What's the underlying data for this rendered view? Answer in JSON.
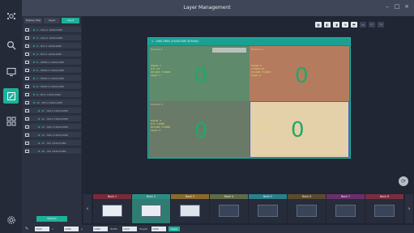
{
  "window": {
    "title": "Layer Management"
  },
  "colors": {
    "accent": "#1db09a",
    "screen_border": "#20b3a4",
    "selected_window_border": "#4b62c4"
  },
  "rail": {
    "items": [
      {
        "icon": "settings-cluster-icon"
      },
      {
        "icon": "search-icon"
      },
      {
        "icon": "monitor-icon"
      },
      {
        "icon": "layer-edit-icon",
        "active": true
      },
      {
        "icon": "grid-icon"
      },
      {
        "icon": "gear-icon"
      }
    ]
  },
  "panel": {
    "tabs": [
      {
        "label": "Display Disp"
      },
      {
        "label": "Layer"
      },
      {
        "label": "Input"
      }
    ],
    "rows": [
      {
        "label": "1 - VGA-1 1920x1080"
      },
      {
        "label": "2 - VGA-2 1920x1080"
      },
      {
        "label": "3 - DVI-1 1920x1080"
      },
      {
        "label": "4 - DVI-2 1920x1080"
      },
      {
        "label": "5 - HDMI-1 1920x1080"
      },
      {
        "label": "6 - HDMI-2 1920x1080"
      },
      {
        "label": "7 - HDMI-3 1920x1080"
      },
      {
        "label": "8 - HDMI-4 1920x1080"
      },
      {
        "label": "9 - DP-1 1920x1080"
      },
      {
        "label": "10 - DP-2 1920x1080"
      },
      {
        "label": "11 - SDI-1 1920x1080"
      },
      {
        "label": "12 - SDI-2 1920x1080"
      },
      {
        "label": "13 - SDI-3 1920x1080"
      },
      {
        "label": "14 - SDI-4 1920x1080"
      },
      {
        "label": "15 - IP-1 1920x1080"
      },
      {
        "label": "16 - IP-2 1920x1080"
      }
    ],
    "action_label": "Refresh"
  },
  "toolbar": {
    "buttons": [
      "▦",
      "◧",
      "◨",
      "⊞",
      "⬒",
      "≡",
      "↶",
      "↷"
    ]
  },
  "screen": {
    "title": "1 - 1080 DMIX (1920X1080 @ 60Hz)",
    "windows": [
      {
        "name": "Window 1",
        "info": "Signal: 1\nX:0  Y:0\nW:1920  H:1080\nLayer: 1",
        "value": "0"
      },
      {
        "name": "Window 2",
        "info": "Signal: 2\nX:1920 Y:0\nW:1920  H:1080\nLayer: 2",
        "value": "0"
      },
      {
        "name": "Window 3",
        "info": "Signal: 3\nX:0  Y:1080\nW:1920  H:1080\nLayer: 3",
        "value": "0"
      },
      {
        "name": "Window 4",
        "info": "Signal: 4\nX:1920 Y:1080\nW:1920  H:1080\nLayer: 4",
        "value": "0"
      }
    ]
  },
  "banks": {
    "prev_label": "‹",
    "next_label": "›",
    "items": [
      {
        "label": "Bank 1",
        "color": "#7a2a3a"
      },
      {
        "label": "Bank 2",
        "color": "#2d8c80",
        "active": true
      },
      {
        "label": "Bank 3",
        "color": "#8a6a2f"
      },
      {
        "label": "Bank 4",
        "color": "#5f6a4a"
      },
      {
        "label": "Bank 5",
        "color": "#2b7f8a"
      },
      {
        "label": "Bank 6",
        "color": "#5c4a2e"
      },
      {
        "label": "Bank 7",
        "color": "#6a2f6a"
      },
      {
        "label": "Bank 8",
        "color": "#7a2e3d"
      }
    ]
  },
  "bottombar": {
    "items": [
      {
        "type": "field",
        "text": "1920"
      },
      {
        "type": "label",
        "text": "x"
      },
      {
        "type": "field",
        "text": "1080"
      },
      {
        "type": "label",
        "text": "y"
      },
      {
        "type": "field",
        "text": "1080"
      },
      {
        "type": "label",
        "text": "Width"
      },
      {
        "type": "field",
        "text": "1920"
      },
      {
        "type": "label",
        "text": "Height"
      },
      {
        "type": "field",
        "text": "1080"
      },
      {
        "type": "button",
        "text": "Apply"
      }
    ]
  }
}
